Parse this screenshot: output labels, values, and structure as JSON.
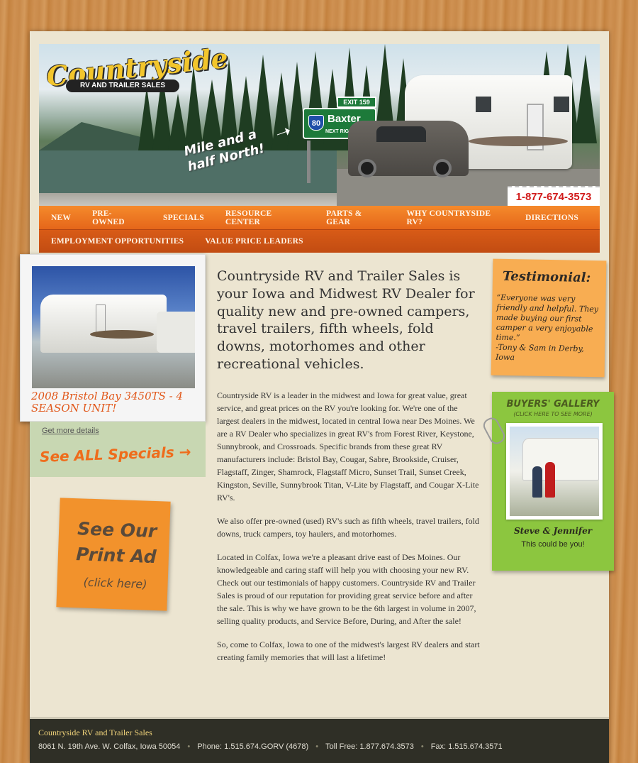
{
  "header": {
    "logo_word": "Countryside",
    "logo_tag": "RV AND TRAILER SALES",
    "tagline_line1": "Mile and a",
    "tagline_line2": "half North!",
    "sign_exit": "EXIT 159",
    "sign_route": "80",
    "sign_city": "Baxter",
    "sign_next": "NEXT RIGHT",
    "phone": "1-877-674-3573"
  },
  "nav": {
    "row1": [
      "NEW",
      "PRE-OWNED",
      "SPECIALS",
      "RESOURCE CENTER",
      "PARTS & GEAR",
      "WHY COUNTRYSIDE RV?",
      "DIRECTIONS"
    ],
    "row2": [
      "EMPLOYMENT OPPORTUNITIES",
      "VALUE PRICE LEADERS"
    ]
  },
  "special": {
    "title": "2008 Bristol Bay 3450TS - 4 SEASON UNIT!",
    "details_link": "Get more details",
    "see_all": "See ALL Specials →"
  },
  "print_ad": {
    "line1": "See Our",
    "line2": "Print Ad",
    "line3": "(click here)"
  },
  "main": {
    "intro": "Countryside RV and Trailer Sales is your Iowa and Midwest RV Dealer for quality new and pre-owned campers, travel trailers, fifth wheels, fold downs, motorhomes and other recreational vehicles.",
    "p1": "Countryside RV is a leader in the midwest and Iowa for great value, great service, and great prices on the RV you're looking for. We're one of the largest dealers in the midwest, located in central Iowa near Des Moines. We are a RV Dealer who specializes in great RV's from Forest River, Keystone, Sunnybrook, and Crossroads. Specific brands from these great RV manufacturers include: Bristol Bay, Cougar, Sabre, Brookside, Cruiser, Flagstaff, Zinger, Shamrock, Flagstaff Micro, Sunset Trail, Sunset Creek, Kingston, Seville, Sunnybrook Titan, V-Lite by Flagstaff, and Cougar X-Lite RV's.",
    "p2": "We also offer pre-owned (used) RV's such as fifth wheels, travel trailers, fold downs, truck campers, toy haulers, and motorhomes.",
    "p3": "Located in Colfax, Iowa we're a pleasant drive east of Des Moines. Our knowledgeable and caring staff will help you with choosing your new RV. Check out our testimonials of happy customers. Countryside RV and Trailer Sales is proud of our reputation for providing great service before and after the sale. This is why we have grown to be the 6th largest in volume in 2007, selling quality products, and Service Before, During, and After the sale!",
    "p4": "So, come to Colfax, Iowa to one of the midwest's largest RV dealers and start creating family memories that will last a lifetime!"
  },
  "testimonial": {
    "heading": "Testimonial:",
    "quote": "“Everyone was very friendly and helpful. They made buying our first camper a very enjoyable time.”",
    "author": "-Tony & Sam in Derby, Iowa"
  },
  "gallery": {
    "heading": "BUYERS' GALLERY",
    "sub": "(CLICK HERE TO SEE MORE)",
    "names": "Steve & Jennifer",
    "caption": "This could be you!"
  },
  "footer": {
    "company": "Countryside RV and Trailer Sales",
    "address": "8061 N. 19th Ave. W. Colfax, Iowa 50054",
    "phone": "Phone: 1.515.674.GORV (4678)",
    "tollfree": "Toll Free: 1.877.674.3573",
    "fax": "Fax: 1.515.674.3571"
  },
  "colors": {
    "nav_orange": "#f58a2b",
    "accent_orange": "#e1581b",
    "gallery_green": "#8cc63f",
    "footer_bg": "#2f2f26"
  }
}
